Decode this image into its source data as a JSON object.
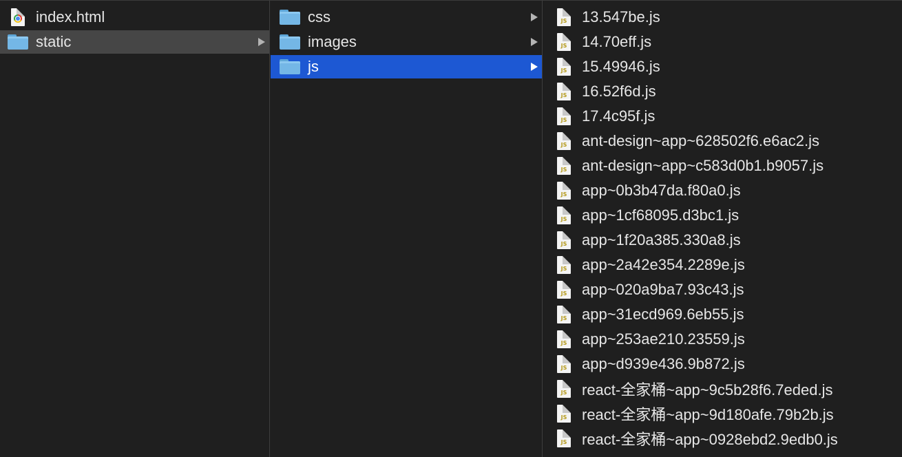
{
  "column1": {
    "items": [
      {
        "label": "index.html",
        "icon": "html-file-icon",
        "selected": false,
        "has_children": false
      },
      {
        "label": "static",
        "icon": "folder-icon",
        "selected": true,
        "has_children": true
      }
    ]
  },
  "column2": {
    "items": [
      {
        "label": "css",
        "icon": "folder-icon",
        "selected": false,
        "has_children": true
      },
      {
        "label": "images",
        "icon": "folder-icon",
        "selected": false,
        "has_children": true
      },
      {
        "label": "js",
        "icon": "folder-icon",
        "selected": true,
        "has_children": true
      }
    ]
  },
  "column3": {
    "items": [
      {
        "label": "13.547be.js"
      },
      {
        "label": "14.70eff.js"
      },
      {
        "label": "15.49946.js"
      },
      {
        "label": "16.52f6d.js"
      },
      {
        "label": "17.4c95f.js"
      },
      {
        "label": "ant-design~app~628502f6.e6ac2.js"
      },
      {
        "label": "ant-design~app~c583d0b1.b9057.js"
      },
      {
        "label": "app~0b3b47da.f80a0.js"
      },
      {
        "label": "app~1cf68095.d3bc1.js"
      },
      {
        "label": "app~1f20a385.330a8.js"
      },
      {
        "label": "app~2a42e354.2289e.js"
      },
      {
        "label": "app~020a9ba7.93c43.js"
      },
      {
        "label": "app~31ecd969.6eb55.js"
      },
      {
        "label": "app~253ae210.23559.js"
      },
      {
        "label": "app~d939e436.9b872.js"
      },
      {
        "label": "react-全家桶~app~9c5b28f6.7eded.js"
      },
      {
        "label": "react-全家桶~app~9d180afe.79b2b.js"
      },
      {
        "label": "react-全家桶~app~0928ebd2.9edb0.js"
      }
    ],
    "file_icon_text": "JS"
  },
  "colors": {
    "background": "#1f1f1f",
    "selection_active": "#1d58d3",
    "selection_inactive": "#464646",
    "folder": "#74b7e6"
  }
}
